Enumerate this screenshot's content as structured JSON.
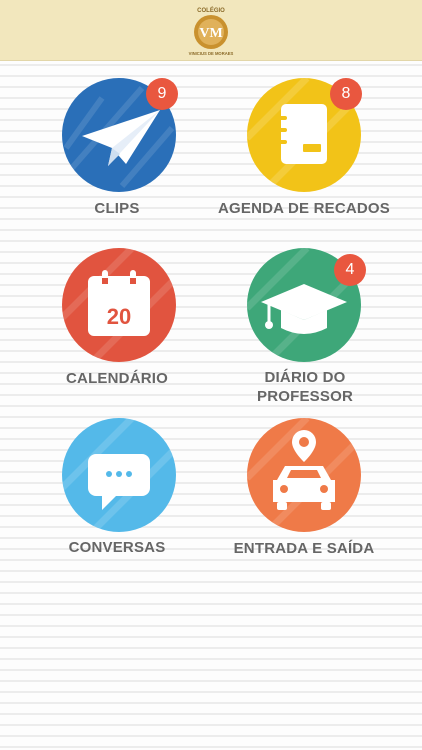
{
  "header": {
    "logo_text_top": "COLÉGIO",
    "logo_monogram": "VM",
    "logo_text_bottom": "VINICIUS DE MORAES"
  },
  "tiles": [
    {
      "label": "CLIPS",
      "badge": "9",
      "icon": "paper-plane-icon",
      "color": "#2a6fb8"
    },
    {
      "label": "AGENDA DE RECADOS",
      "badge": "8",
      "icon": "notebook-icon",
      "color": "#f2c318"
    },
    {
      "label": "CALENDÁRIO",
      "badge": "",
      "day": "20",
      "icon": "calendar-icon",
      "color": "#e1543f"
    },
    {
      "label_line1": "DIÁRIO DO",
      "label_line2": "PROFESSOR",
      "badge": "4",
      "icon": "graduation-cap-icon",
      "color": "#3ea779"
    },
    {
      "label": "CONVERSAS",
      "badge": "",
      "icon": "chat-bubble-icon",
      "color": "#54b9e9"
    },
    {
      "label": "ENTRADA E SAÍDA",
      "badge": "",
      "icon": "car-location-icon",
      "color": "#ef7a48"
    }
  ]
}
